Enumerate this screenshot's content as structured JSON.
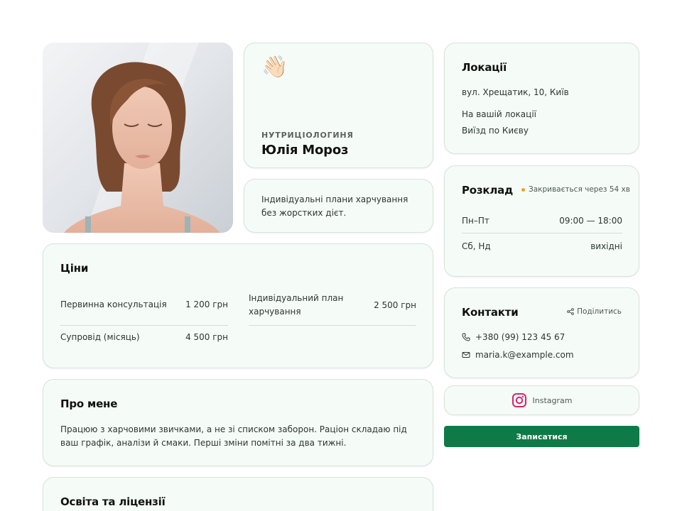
{
  "profile": {
    "wave_emoji": "👋🏻",
    "role": "НУТРИЦІОЛОГИНЯ",
    "name": "Юлія Мороз",
    "tagline": "Індивідуальні плани харчування без жорстких дієт."
  },
  "prices": {
    "title": "Ціни",
    "items": [
      {
        "label": "Первинна консультація",
        "price": "1 200 грн"
      },
      {
        "label": "Індивідуальний план харчування",
        "price": "2 500 грн"
      },
      {
        "label": "Супровід (місяць)",
        "price": "4 500 грн"
      }
    ]
  },
  "about": {
    "title": "Про мене",
    "text": "Працюю з харчовими звичками, а не зі списком заборон. Раціон складаю під ваш графік, аналізи й смаки. Перші зміни помітні за два тижні."
  },
  "education": {
    "title": "Освіта та ліцензії"
  },
  "locations": {
    "title": "Локації",
    "address": "вул. Хрещатик, 10, Київ",
    "option1": "На вашій локації",
    "option2": "Виїзд по Києву"
  },
  "schedule": {
    "title": "Розклад",
    "status": "Закривається через 54 хв",
    "status_color": "#f0a020",
    "rows": [
      {
        "days": "Пн–Пт",
        "hours": "09:00 — 18:00"
      },
      {
        "days": "Сб, Нд",
        "hours": "вихідні"
      }
    ]
  },
  "contacts": {
    "title": "Контакти",
    "share_label": "Поділитись",
    "phone": "+380 (99) 123 45 67",
    "email": "maria.k@example.com"
  },
  "instagram": {
    "label": "Instagram",
    "icon_color": "#d6246e"
  },
  "cta": {
    "label": "Записатися",
    "color": "#0e7a47"
  }
}
